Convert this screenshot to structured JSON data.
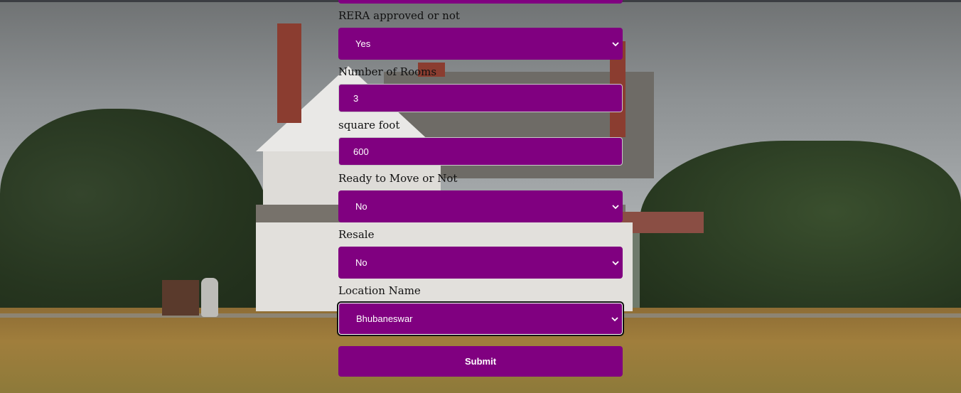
{
  "form": {
    "fields": [
      {
        "label": "RERA approved or not",
        "value": "Yes",
        "kind": "select"
      },
      {
        "label": "Number of Rooms",
        "value": "3",
        "kind": "input"
      },
      {
        "label": "square foot",
        "value": "600",
        "kind": "input"
      },
      {
        "label": "Ready to Move or Not",
        "value": "No",
        "kind": "select"
      },
      {
        "label": "Resale",
        "value": "No",
        "kind": "select"
      },
      {
        "label": "Location Name",
        "value": "Bhubaneswar",
        "kind": "select"
      }
    ],
    "submit_label": "Submit"
  },
  "colors": {
    "accent": "#800080",
    "text_on_accent": "#ffffff",
    "label_text": "#111111"
  },
  "icons": {
    "dropdown": "chevron-down-icon"
  }
}
